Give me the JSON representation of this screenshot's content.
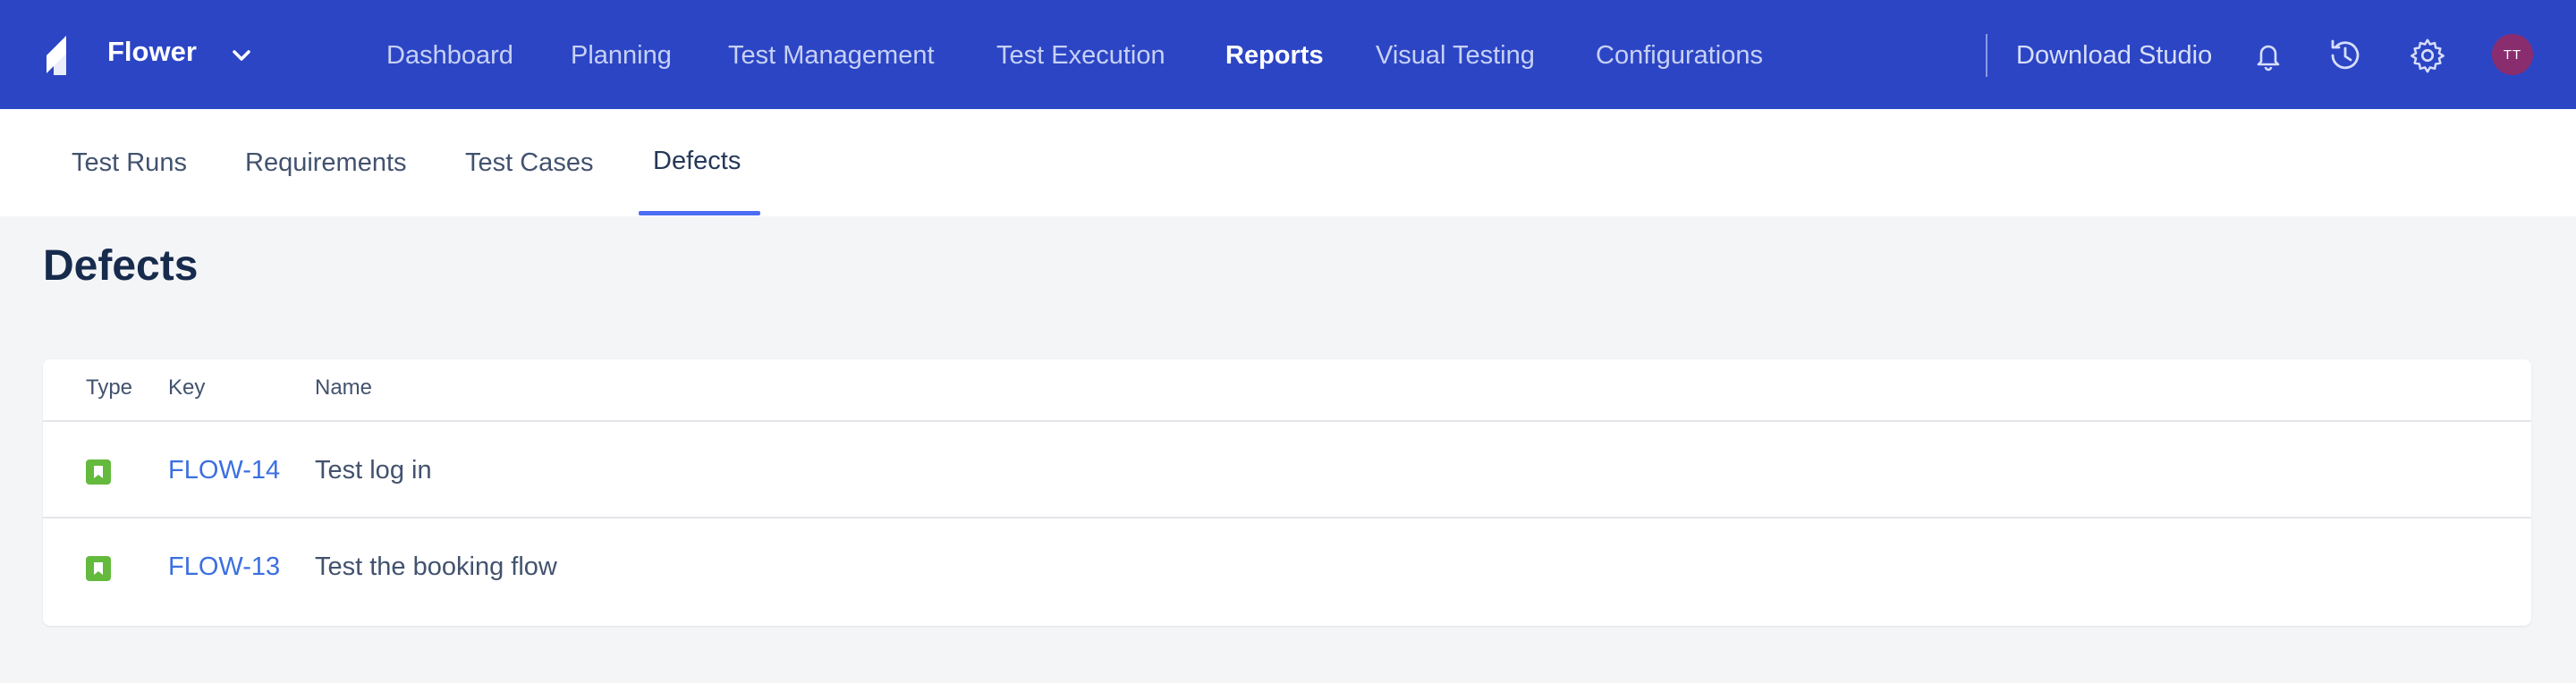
{
  "app": {
    "name": "Flower",
    "avatar_initials": "TT",
    "download_label": "Download Studio"
  },
  "nav": {
    "items": [
      {
        "label": "Dashboard"
      },
      {
        "label": "Planning"
      },
      {
        "label": "Test Management"
      },
      {
        "label": "Test Execution"
      },
      {
        "label": "Reports",
        "active": true
      },
      {
        "label": "Visual Testing"
      },
      {
        "label": "Configurations"
      }
    ]
  },
  "subnav": {
    "tabs": [
      {
        "label": "Test Runs"
      },
      {
        "label": "Requirements"
      },
      {
        "label": "Test Cases"
      },
      {
        "label": "Defects",
        "active": true
      }
    ]
  },
  "page": {
    "title": "Defects"
  },
  "table": {
    "columns": [
      "Type",
      "Key",
      "Name"
    ],
    "rows": [
      {
        "type_icon": "story-icon",
        "key": "FLOW-14",
        "name": "Test log in"
      },
      {
        "type_icon": "story-icon",
        "key": "FLOW-13",
        "name": "Test the booking flow"
      }
    ]
  },
  "colors": {
    "header_bg": "#2c45c5",
    "accent": "#4c6ef5",
    "link": "#3b6fe0",
    "story_icon": "#63ba3c",
    "avatar": "#8a2d6e"
  },
  "icons": [
    "logo-icon",
    "chevron-down-icon",
    "bell-icon",
    "history-icon",
    "gear-icon",
    "story-icon"
  ]
}
